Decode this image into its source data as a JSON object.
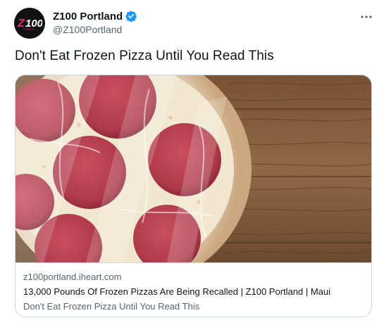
{
  "author": {
    "display_name": "Z100 Portland",
    "handle": "@Z100Portland",
    "avatar_logo_text": "Z100",
    "avatar_logo_subtext": "Portland",
    "verified": true
  },
  "tweet": {
    "text": "Don't Eat Frozen Pizza Until You Read This"
  },
  "card": {
    "domain": "z100portland.iheart.com",
    "title": "13,000 Pounds Of Frozen Pizzas Are Being Recalled | Z100 Portland | Maui",
    "description": "Don't Eat Frozen Pizza Until You Read This",
    "image_subject": "frozen pepperoni pizza wrapped in plastic on a wooden table"
  },
  "icons": {
    "verified": "verified-badge-icon",
    "more": "more-options-icon"
  },
  "colors": {
    "verified_blue": "#1d9bf0",
    "secondary_text": "#536471",
    "primary_text": "#0f1419",
    "border": "#cfd9de",
    "logo_pink": "#e0227a"
  }
}
